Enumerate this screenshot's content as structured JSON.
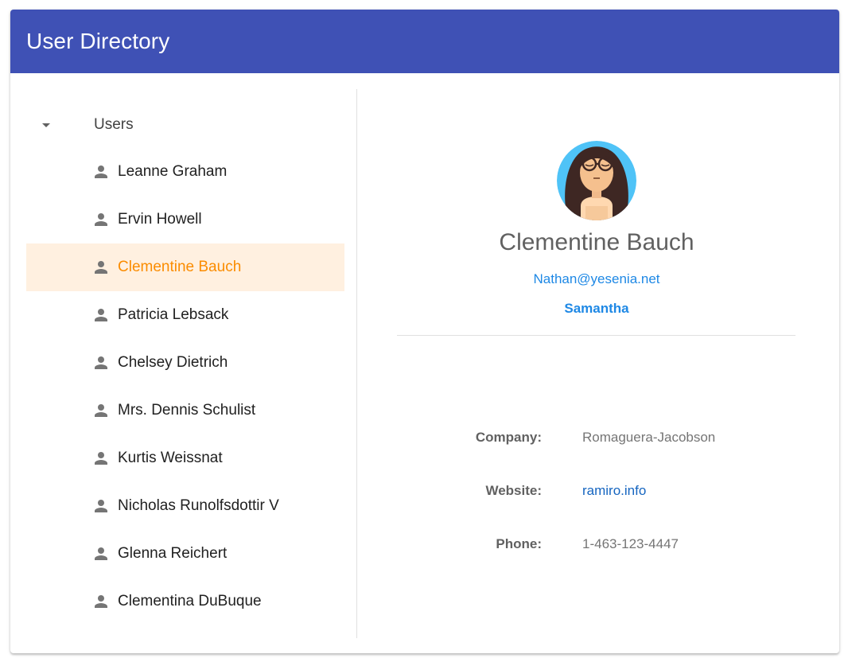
{
  "app": {
    "title": "User Directory",
    "accent_color": "#3f51b5",
    "selected_color": "#fb8c00",
    "link_color": "#1e88e5"
  },
  "tree": {
    "root_label": "Users",
    "toggle_icon": "arrow-drop-down-icon",
    "item_icon": "person-icon",
    "items": [
      {
        "label": "Leanne Graham"
      },
      {
        "label": "Ervin Howell"
      },
      {
        "label": "Clementine Bauch"
      },
      {
        "label": "Patricia Lebsack"
      },
      {
        "label": "Chelsey Dietrich"
      },
      {
        "label": "Mrs. Dennis Schulist"
      },
      {
        "label": "Kurtis Weissnat"
      },
      {
        "label": "Nicholas Runolfsdottir V"
      },
      {
        "label": "Glenna Reichert"
      },
      {
        "label": "Clementina DuBuque"
      }
    ],
    "selected_index": 2
  },
  "detail": {
    "avatar_icon": "woman-with-glasses-avatar",
    "name": "Clementine Bauch",
    "email": "Nathan@yesenia.net",
    "username": "Samantha",
    "fields": {
      "company": {
        "label": "Company:",
        "value": "Romaguera-Jacobson"
      },
      "website": {
        "label": "Website:",
        "value": "ramiro.info"
      },
      "phone": {
        "label": "Phone:",
        "value": "1-463-123-4447"
      }
    }
  }
}
